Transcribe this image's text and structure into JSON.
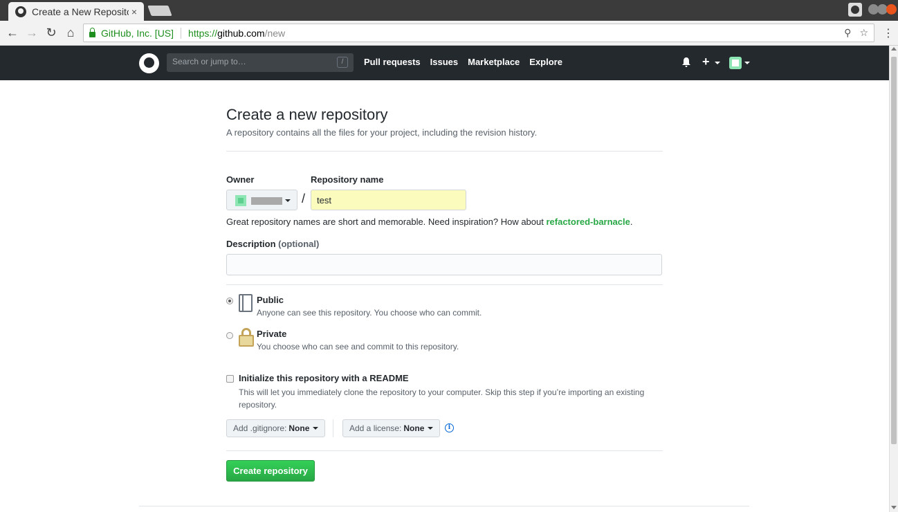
{
  "browser": {
    "tab_title": "Create a New Repository",
    "tab_close": "×",
    "secure_label": "GitHub, Inc. [US]",
    "url_scheme": "https://",
    "url_host": "github.com",
    "url_path": "/new"
  },
  "header": {
    "search_placeholder": "Search or jump to…",
    "slash_key": "/",
    "nav": [
      "Pull requests",
      "Issues",
      "Marketplace",
      "Explore"
    ],
    "plus": "+"
  },
  "page": {
    "title": "Create a new repository",
    "subtitle": "A repository contains all the files for your project, including the revision history."
  },
  "form": {
    "owner_label": "Owner",
    "repo_name_label": "Repository name",
    "slash": "/",
    "repo_name_value": "test",
    "hint_prefix": "Great repository names are short and memorable. Need inspiration? How about ",
    "hint_suggestion": "refactored-barnacle",
    "hint_suffix": ".",
    "description_label": "Description",
    "description_optional": "(optional)",
    "description_value": "",
    "visibility": {
      "public_title": "Public",
      "public_desc": "Anyone can see this repository. You choose who can commit.",
      "private_title": "Private",
      "private_desc": "You choose who can see and commit to this repository.",
      "selected": "public"
    },
    "readme_title": "Initialize this repository with a README",
    "readme_desc": "This will let you immediately clone the repository to your computer. Skip this step if you’re importing an existing repository.",
    "gitignore_label": "Add .gitignore:",
    "gitignore_value": "None",
    "license_label": "Add a license:",
    "license_value": "None",
    "info": "i",
    "create_button": "Create repository"
  },
  "colors": {
    "header_bg": "#24292e",
    "primary_green": "#28a745",
    "repo_input_bg": "#fafbbc"
  }
}
